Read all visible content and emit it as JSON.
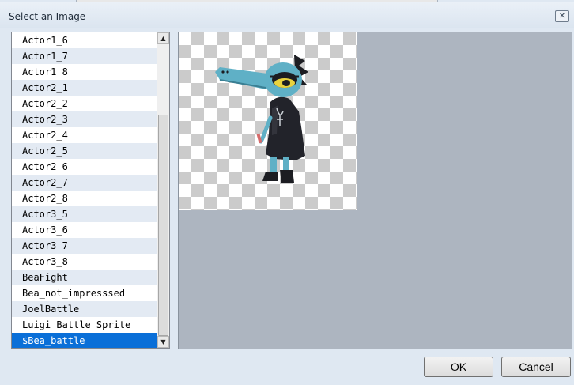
{
  "dialog": {
    "title": "Select an Image",
    "close_icon": "close-icon"
  },
  "file_list": {
    "items": [
      "Actor1_6",
      "Actor1_7",
      "Actor1_8",
      "Actor2_1",
      "Actor2_2",
      "Actor2_3",
      "Actor2_4",
      "Actor2_5",
      "Actor2_6",
      "Actor2_7",
      "Actor2_8",
      "Actor3_5",
      "Actor3_6",
      "Actor3_7",
      "Actor3_8",
      "BeaFight",
      "Bea_not_impresssed",
      "JoelBattle",
      "Luigi Battle Sprite",
      "$Bea_battle"
    ],
    "selected": "$Bea_battle"
  },
  "colors": {
    "selection": "#0a6fd8",
    "alt_row": "#e3eaf3",
    "preview_background": "#adb5c0"
  },
  "buttons": {
    "ok_label": "OK",
    "cancel_label": "Cancel"
  }
}
